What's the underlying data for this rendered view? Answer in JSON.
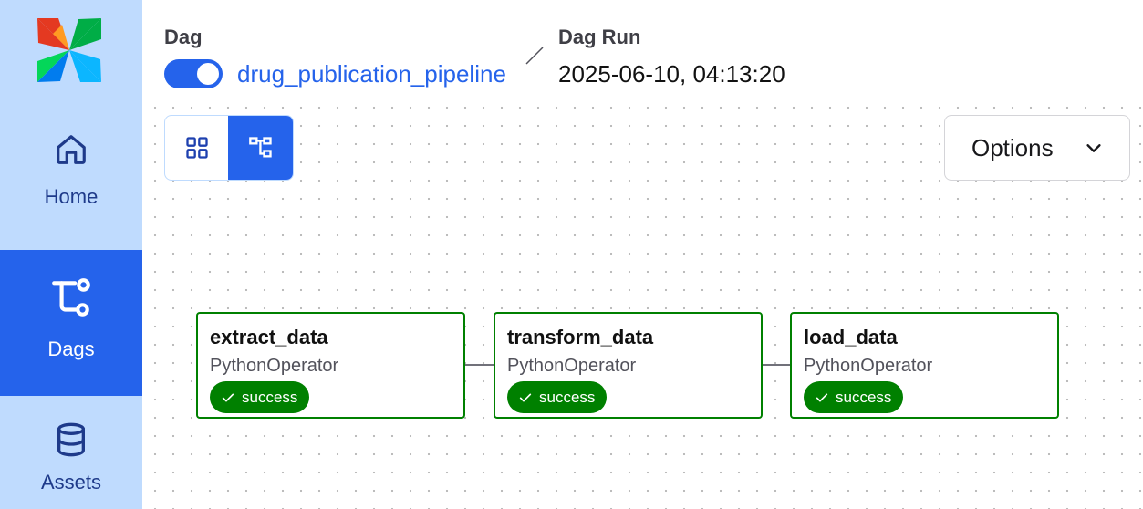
{
  "sidebar": {
    "logo": "airflow-pinwheel-logo",
    "items": [
      {
        "label": "Home",
        "icon": "home-icon"
      },
      {
        "label": "Dags",
        "icon": "dags-icon",
        "active": true
      },
      {
        "label": "Assets",
        "icon": "database-icon"
      }
    ]
  },
  "breadcrumb": {
    "dag_label": "Dag",
    "dag_name": "drug_publication_pipeline",
    "dag_enabled": true,
    "run_label": "Dag Run",
    "run_id": "2025-06-10, 04:13:20"
  },
  "view_toggle": {
    "options": [
      {
        "icon": "grid-view-icon",
        "active": false
      },
      {
        "icon": "graph-view-icon",
        "active": true
      }
    ]
  },
  "options_button": {
    "label": "Options",
    "icon": "chevron-down-icon"
  },
  "tasks": [
    {
      "name": "extract_data",
      "operator": "PythonOperator",
      "status": "success"
    },
    {
      "name": "transform_data",
      "operator": "PythonOperator",
      "status": "success"
    },
    {
      "name": "load_data",
      "operator": "PythonOperator",
      "status": "success"
    }
  ],
  "colors": {
    "sidebar_bg": "#bfdbfe",
    "accent": "#2563eb",
    "success": "#008000"
  }
}
